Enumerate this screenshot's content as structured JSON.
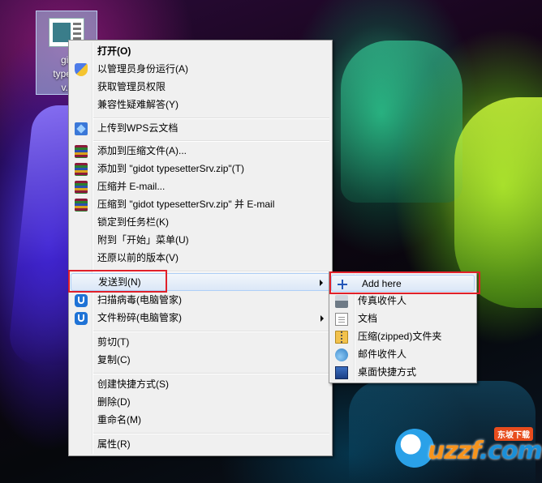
{
  "desktop_icon": {
    "caption": "gid\ntypese\nv.e"
  },
  "context_menu": {
    "items": [
      {
        "label": "打开(O)"
      },
      {
        "label": "以管理员身份运行(A)"
      },
      {
        "label": "获取管理员权限"
      },
      {
        "label": "兼容性疑难解答(Y)"
      },
      {
        "label": "上传到WPS云文档"
      },
      {
        "label": "添加到压缩文件(A)..."
      },
      {
        "label": "添加到 \"gidot typesetterSrv.zip\"(T)"
      },
      {
        "label": "压缩并 E-mail..."
      },
      {
        "label": "压缩到 \"gidot typesetterSrv.zip\" 并 E-mail"
      },
      {
        "label": "锁定到任务栏(K)"
      },
      {
        "label": "附到「开始」菜单(U)"
      },
      {
        "label": "还原以前的版本(V)"
      },
      {
        "label": "发送到(N)"
      },
      {
        "label": "扫描病毒(电脑管家)"
      },
      {
        "label": "文件粉碎(电脑管家)"
      },
      {
        "label": "剪切(T)"
      },
      {
        "label": "复制(C)"
      },
      {
        "label": "创建快捷方式(S)"
      },
      {
        "label": "删除(D)"
      },
      {
        "label": "重命名(M)"
      },
      {
        "label": "属性(R)"
      }
    ]
  },
  "send_to_menu": {
    "items": [
      {
        "label": "Add here",
        "icon": "plus-icon"
      },
      {
        "label": "传真收件人",
        "icon": "fax-icon"
      },
      {
        "label": "文档",
        "icon": "document-icon"
      },
      {
        "label": "压缩(zipped)文件夹",
        "icon": "zip-folder-icon"
      },
      {
        "label": "邮件收件人",
        "icon": "mail-icon"
      },
      {
        "label": "桌面快捷方式",
        "icon": "desktop-icon"
      }
    ]
  },
  "watermark": {
    "text_a": "uzzf",
    "text_b": ".com",
    "tag": "东坡下载"
  }
}
